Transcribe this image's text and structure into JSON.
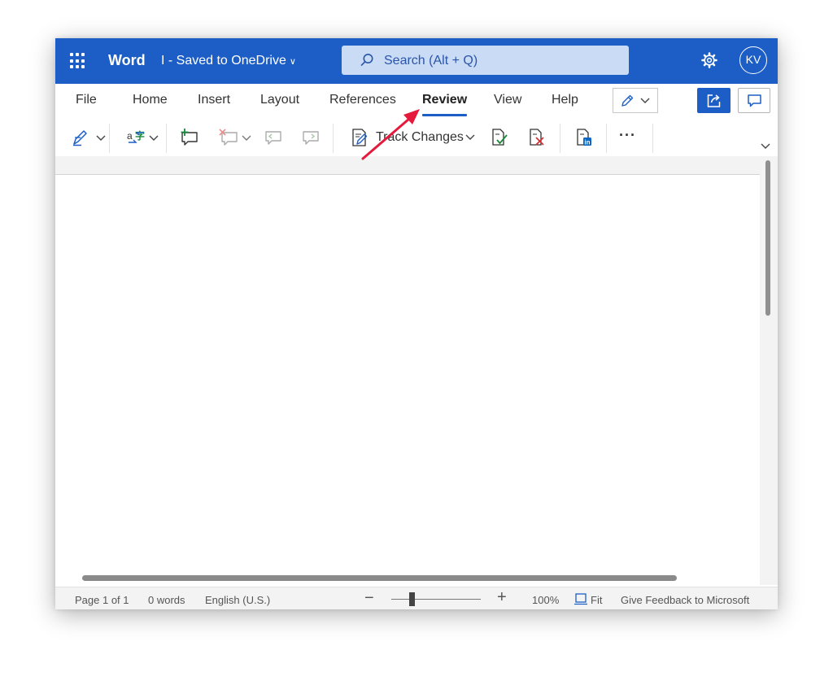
{
  "titlebar": {
    "app_name": "Word",
    "doc_status": "I - Saved to OneDrive",
    "search_placeholder": "Search (Alt + Q)",
    "avatar_initials": "KV",
    "bg_color": "#1c5ec6"
  },
  "tabs": [
    {
      "label": "File",
      "active": false
    },
    {
      "label": "Home",
      "active": false
    },
    {
      "label": "Insert",
      "active": false
    },
    {
      "label": "Layout",
      "active": false
    },
    {
      "label": "References",
      "active": false
    },
    {
      "label": "Review",
      "active": true
    },
    {
      "label": "View",
      "active": false
    },
    {
      "label": "Help",
      "active": false
    }
  ],
  "toolbar": {
    "track_changes_label": "Track Changes",
    "more_glyph": "···"
  },
  "statusbar": {
    "page": "Page 1 of 1",
    "words": "0 words",
    "language": "English (U.S.)",
    "zoom_out": "−",
    "zoom_in": "+",
    "zoom_level": "100%",
    "fit": "Fit",
    "feedback": "Give Feedback to Microsoft"
  },
  "annotation": {
    "arrow_color": "#e5193c"
  }
}
